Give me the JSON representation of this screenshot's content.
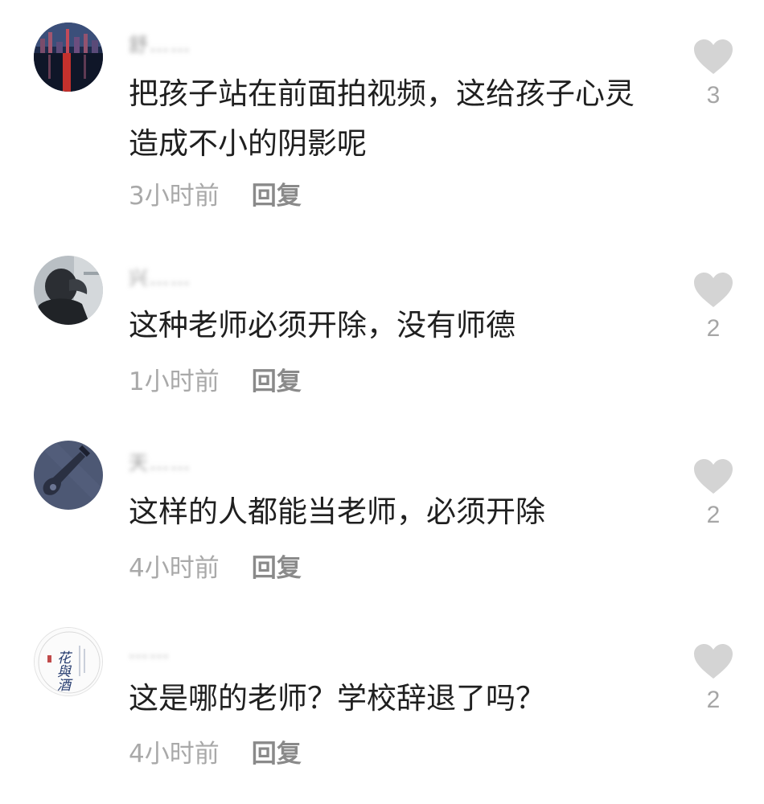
{
  "comments": [
    {
      "username": "舒……",
      "text": "把孩子站在前面拍视频，这给孩子心灵造成不小的阴影呢",
      "time": "3小时前",
      "reply_label": "回复",
      "likes": "3",
      "avatar": "city-night-icon"
    },
    {
      "username": "兴……",
      "text": "这种老师必须开除，没有师德",
      "time": "1小时前",
      "reply_label": "回复",
      "likes": "2",
      "avatar": "person-photo-icon"
    },
    {
      "username": "天……",
      "text": "这样的人都能当老师，必须开除",
      "time": "4小时前",
      "reply_label": "回复",
      "likes": "2",
      "avatar": "guitar-icon"
    },
    {
      "username": "……",
      "text": "这是哪的老师？学校辞退了吗？",
      "time": "4小时前",
      "reply_label": "回复",
      "likes": "2",
      "avatar": "calligraphy-seal-icon",
      "avatar_text": "花與酒"
    }
  ],
  "colors": {
    "heart": "#d4d4d4",
    "text": "#1f1f1f",
    "meta": "#a9a9a9",
    "reply": "#8a8a8a"
  }
}
